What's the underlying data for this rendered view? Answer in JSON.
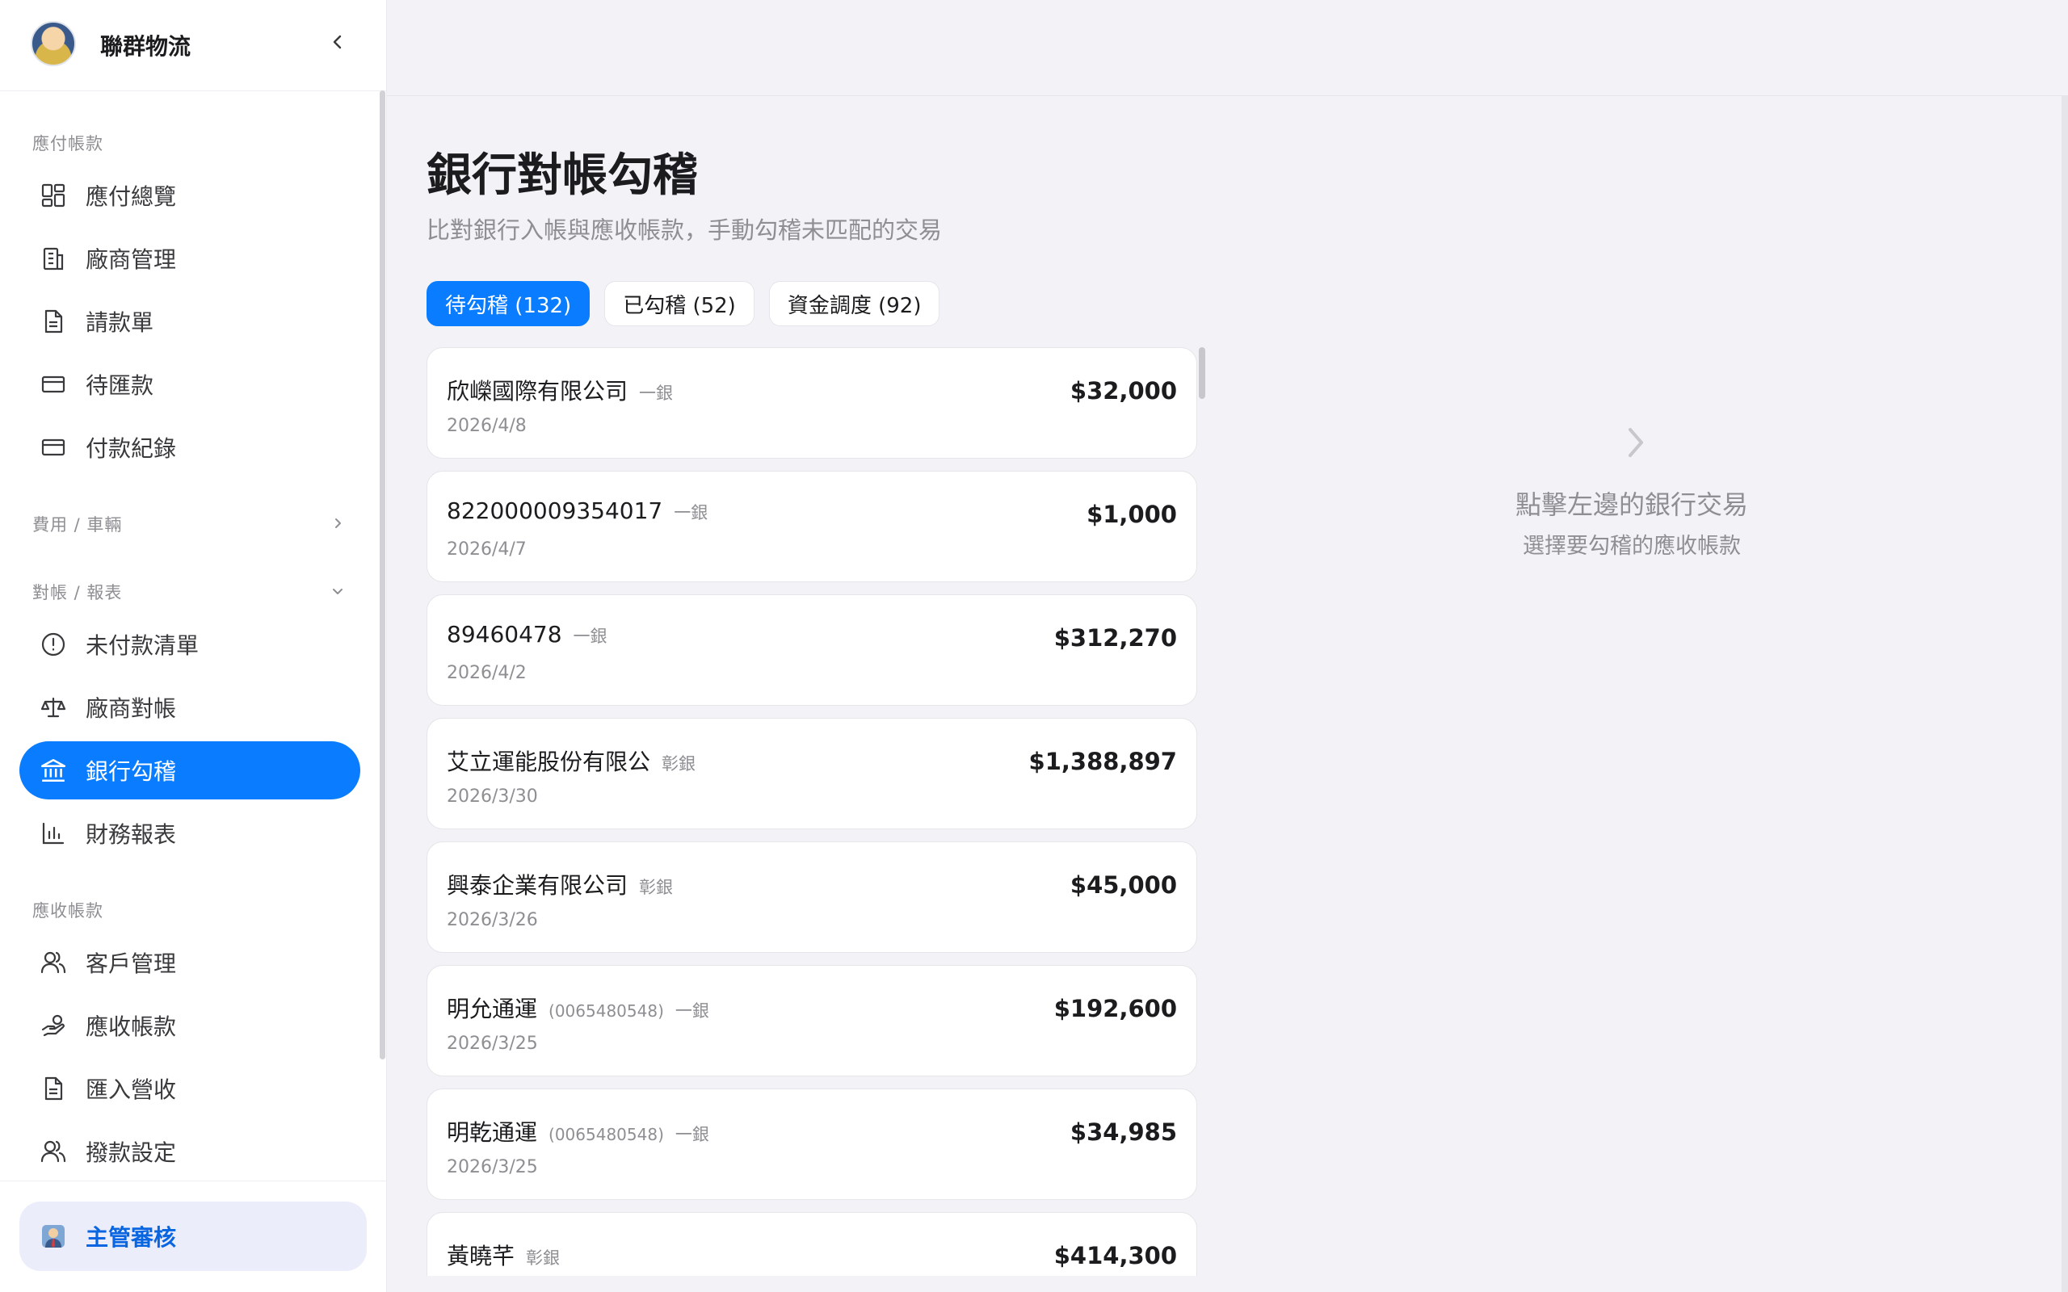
{
  "sidebar": {
    "brand": "聯群物流",
    "sections": {
      "payables": "應付帳款",
      "expenses": "費用 / 車輛",
      "reconciliation": "對帳 / 報表",
      "receivables": "應收帳款"
    },
    "items": {
      "ap_overview": "應付總覽",
      "vendor_mgmt": "廠商管理",
      "payment_request": "請款單",
      "pending_remit": "待匯款",
      "payment_records": "付款紀錄",
      "unpaid_list": "未付款清單",
      "vendor_recon": "廠商對帳",
      "bank_check": "銀行勾稽",
      "financial_reports": "財務報表",
      "customer_mgmt": "客戶管理",
      "ar": "應收帳款",
      "import_revenue": "匯入營收",
      "disbursement_settings": "撥款設定"
    },
    "supervisor": "主管審核"
  },
  "main": {
    "title": "銀行對帳勾稽",
    "subtitle": "比對銀行入帳與應收帳款，手動勾稽未匹配的交易",
    "tabs": [
      "待勾稽 (132)",
      "已勾稽 (52)",
      "資金調度 (92)"
    ],
    "transactions": [
      {
        "name": "欣嶸國際有限公司",
        "account": "",
        "bank": "一銀",
        "date": "2026/4/8",
        "amount": "$32,000"
      },
      {
        "name": "822000009354017",
        "account": "",
        "bank": "一銀",
        "date": "2026/4/7",
        "amount": "$1,000"
      },
      {
        "name": "89460478",
        "account": "",
        "bank": "一銀",
        "date": "2026/4/2",
        "amount": "$312,270"
      },
      {
        "name": "艾立運能股份有限公",
        "account": "",
        "bank": "彰銀",
        "date": "2026/3/30",
        "amount": "$1,388,897"
      },
      {
        "name": "興泰企業有限公司",
        "account": "",
        "bank": "彰銀",
        "date": "2026/3/26",
        "amount": "$45,000"
      },
      {
        "name": "明允通運",
        "account": "(0065480548)",
        "bank": "一銀",
        "date": "2026/3/25",
        "amount": "$192,600"
      },
      {
        "name": "明乾通運",
        "account": "(0065480548)",
        "bank": "一銀",
        "date": "2026/3/25",
        "amount": "$34,985"
      },
      {
        "name": "黃曉芊",
        "account": "",
        "bank": "彰銀",
        "date": "",
        "amount": "$414,300"
      }
    ],
    "detail_empty": {
      "line1": "點擊左邊的銀行交易",
      "line2": "選擇要勾稽的應收帳款"
    }
  },
  "colors": {
    "accent": "#0a7cff",
    "supervisor_bg": "#ecedfb",
    "page_bg": "#f2f2f7"
  }
}
